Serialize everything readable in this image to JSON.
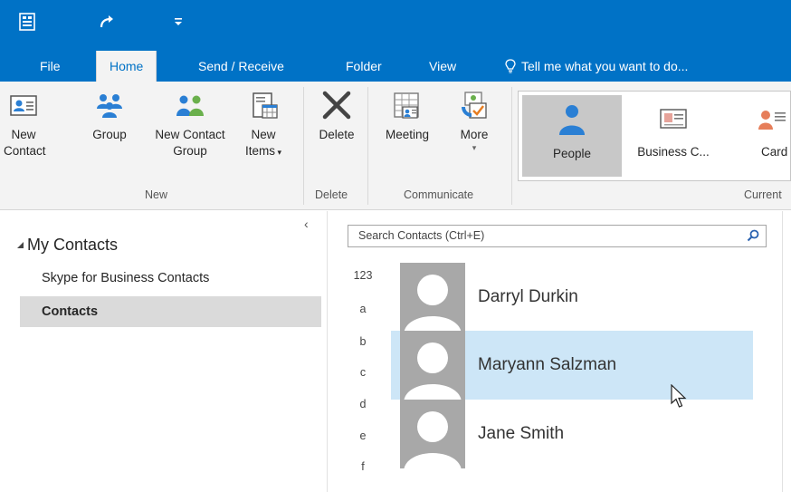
{
  "tabs": [
    {
      "label": "File"
    },
    {
      "label": "Home"
    },
    {
      "label": "Send / Receive"
    },
    {
      "label": "Folder"
    },
    {
      "label": "View"
    }
  ],
  "tell_me": "Tell me what you want to do...",
  "ribbon": {
    "new_contact": "New\nContact",
    "group": "Group",
    "new_contact_group": "New Contact\nGroup",
    "new_items": "New\nItems",
    "delete": "Delete",
    "meeting": "Meeting",
    "more": "More",
    "gallery": {
      "people": "People",
      "business_card": "Business C...",
      "card": "Card"
    },
    "group_labels": {
      "new": "New",
      "delete": "Delete",
      "communicate": "Communicate",
      "current_view": "Current"
    }
  },
  "nav": {
    "header": "My Contacts",
    "items": [
      {
        "label": "Skype for Business Contacts"
      },
      {
        "label": "Contacts"
      }
    ]
  },
  "search": {
    "placeholder": "Search Contacts (Ctrl+E)"
  },
  "index": [
    "123",
    "a",
    "b",
    "c",
    "d",
    "e",
    "f"
  ],
  "contacts": [
    {
      "name": "Darryl Durkin"
    },
    {
      "name": "Maryann Salzman"
    },
    {
      "name": "Jane Smith"
    }
  ],
  "colors": {
    "accent": "#0072c6",
    "selection": "#cde6f7",
    "nav_selection": "#dadada",
    "avatar_bg": "#a8a8a8"
  }
}
